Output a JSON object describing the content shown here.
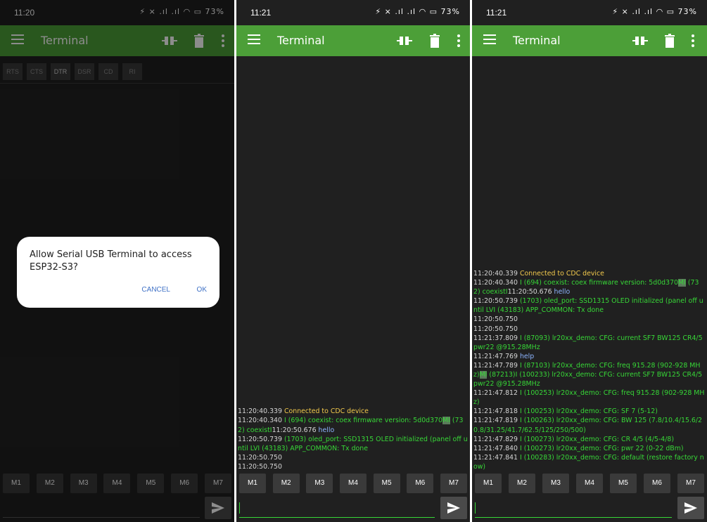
{
  "panels": [
    {
      "status": {
        "time": "11:20",
        "icons": "⚡ ⨯ .ıl .ıl ◠ ▭ 73%"
      },
      "appbar": {
        "title": "Terminal"
      },
      "controls": [
        "RTS",
        "CTS",
        "DTR",
        "DSR",
        "CD",
        "RI"
      ],
      "dialog": {
        "message": "Allow Serial USB Terminal to access ESP32-S3?",
        "cancel": "CANCEL",
        "ok": "OK"
      },
      "macros": [
        "M1",
        "M2",
        "M3",
        "M4",
        "M5",
        "M6",
        "M7"
      ]
    },
    {
      "status": {
        "time": "11:21",
        "icons": "⚡ ⨯ .ıl .ıl ◠ ▭ 73%"
      },
      "appbar": {
        "title": "Terminal"
      },
      "log": [
        [
          {
            "t": "11:20:40.339 ",
            "c": "ts"
          },
          {
            "t": "Connected to CDC device",
            "c": "yellow"
          }
        ],
        [
          {
            "t": "11:20:40.340 ",
            "c": "ts"
          },
          {
            "t": "I (694) coexist: coex firmware version: 5d0d370",
            "c": "green"
          },
          {
            "t": "MI",
            "c": "hl"
          },
          {
            "t": " (732) coexistI",
            "c": "green"
          },
          {
            "t": "11:20:50.676 ",
            "c": "ts"
          },
          {
            "t": "hello",
            "c": "blue"
          }
        ],
        [
          {
            "t": "11:20:50.739 ",
            "c": "ts"
          },
          {
            "t": "(1703) oled_port: SSD1315 OLED initialized (panel off until LVI (43183) APP_COMMON: Tx done",
            "c": "green"
          }
        ],
        [
          {
            "t": "11:20:50.750",
            "c": "ts"
          }
        ],
        [
          {
            "t": "11:20:50.750",
            "c": "ts"
          }
        ]
      ],
      "macros": [
        "M1",
        "M2",
        "M3",
        "M4",
        "M5",
        "M6",
        "M7"
      ]
    },
    {
      "status": {
        "time": "11:21",
        "icons": "⚡ ⨯ .ıl .ıl ◠ ▭ 73%"
      },
      "appbar": {
        "title": "Terminal"
      },
      "log": [
        [
          {
            "t": "11:20:40.339 ",
            "c": "ts"
          },
          {
            "t": "Connected to CDC device",
            "c": "yellow"
          }
        ],
        [
          {
            "t": "11:20:40.340 ",
            "c": "ts"
          },
          {
            "t": "I (694) coexist: coex firmware version: 5d0d370",
            "c": "green"
          },
          {
            "t": "MI",
            "c": "hl"
          },
          {
            "t": " (732) coexistI",
            "c": "green"
          },
          {
            "t": "11:20:50.676 ",
            "c": "ts"
          },
          {
            "t": "hello",
            "c": "blue"
          }
        ],
        [
          {
            "t": "11:20:50.739 ",
            "c": "ts"
          },
          {
            "t": "(1703) oled_port: SSD1315 OLED initialized (panel off until LVI (43183) APP_COMMON: Tx done",
            "c": "green"
          }
        ],
        [
          {
            "t": "11:20:50.750",
            "c": "ts"
          }
        ],
        [
          {
            "t": "11:20:50.750",
            "c": "ts"
          }
        ],
        [
          {
            "t": "11:21:37.809 ",
            "c": "ts"
          },
          {
            "t": "I (87093) lr20xx_demo: CFG: current SF7 BW125 CR4/5 pwr22 @915.28MHz",
            "c": "green"
          }
        ],
        [
          {
            "t": "11:21:47.769 ",
            "c": "ts"
          },
          {
            "t": "help",
            "c": "blue"
          }
        ],
        [
          {
            "t": "11:21:47.789 ",
            "c": "ts"
          },
          {
            "t": "I (87103) lr20xx_demo: CFG: freq 915.28 (902-928 MHz)",
            "c": "green"
          },
          {
            "t": "MI",
            "c": "hl"
          },
          {
            "t": " (87213)I (100233) lr20xx_demo: CFG: current SF7 BW125 CR4/5 pwr22 @915.28MHz",
            "c": "green"
          }
        ],
        [
          {
            "t": "11:21:47.812 ",
            "c": "ts"
          },
          {
            "t": "I (100253) lr20xx_demo: CFG: freq 915.28 (902-928 MHz)",
            "c": "green"
          }
        ],
        [
          {
            "t": "11:21:47.818 ",
            "c": "ts"
          },
          {
            "t": "I (100253) lr20xx_demo: CFG: SF 7 (5-12)",
            "c": "green"
          }
        ],
        [
          {
            "t": "11:21:47.819 ",
            "c": "ts"
          },
          {
            "t": "I (100263) lr20xx_demo: CFG: BW 125 (7.8/10.4/15.6/20.8/31.25/41.7/62.5/125/250/500)",
            "c": "green"
          }
        ],
        [
          {
            "t": "11:21:47.829 ",
            "c": "ts"
          },
          {
            "t": "I (100273) lr20xx_demo: CFG: CR 4/5 (4/5-4/8)",
            "c": "green"
          }
        ],
        [
          {
            "t": "11:21:47.840 ",
            "c": "ts"
          },
          {
            "t": "I (100273) lr20xx_demo: CFG: pwr 22 (0-22 dBm)",
            "c": "green"
          }
        ],
        [
          {
            "t": "11:21:47.841 ",
            "c": "ts"
          },
          {
            "t": "I (100283) lr20xx_demo: CFG: default (restore factory now)",
            "c": "green"
          }
        ]
      ],
      "macros": [
        "M1",
        "M2",
        "M3",
        "M4",
        "M5",
        "M6",
        "M7"
      ]
    }
  ],
  "colors": {
    "appbar": "#4c9f38",
    "background": "#202020",
    "log_green": "#37d737",
    "log_yellow": "#f2c94c",
    "log_blue": "#8db4ff"
  },
  "icons": [
    "menu-icon",
    "connect-icon",
    "trash-icon",
    "more-icon",
    "send-icon"
  ]
}
